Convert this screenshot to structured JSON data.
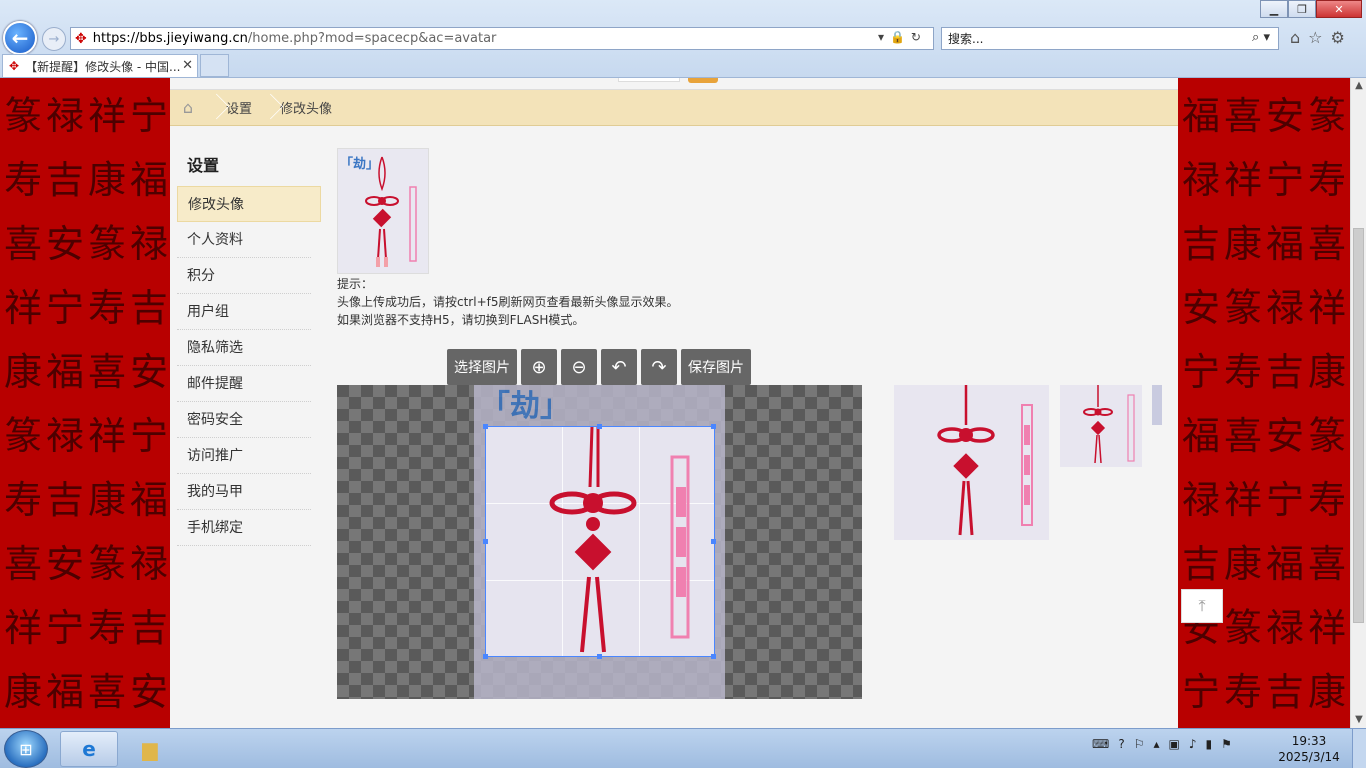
{
  "browser": {
    "window_controls": {
      "minimize": "▁",
      "maximize": "❐",
      "close": "✕"
    },
    "back_icon": "arrow-left-icon",
    "url_host": "https://bbs.jieyiwang.cn",
    "url_path": "/home.php?mod=spacecp&ac=avatar",
    "search_placeholder": "搜索...",
    "tab_title": "【新提醒】修改头像 - 中国...",
    "tab_close": "✕"
  },
  "breadcrumb": {
    "items": [
      "设置",
      "修改头像"
    ]
  },
  "sidebar": {
    "title": "设置",
    "items": [
      {
        "label": "修改头像",
        "active": true
      },
      {
        "label": "个人资料"
      },
      {
        "label": "积分"
      },
      {
        "label": "用户组"
      },
      {
        "label": "隐私筛选"
      },
      {
        "label": "邮件提醒"
      },
      {
        "label": "密码安全"
      },
      {
        "label": "访问推广"
      },
      {
        "label": "我的马甲"
      },
      {
        "label": "手机绑定"
      }
    ]
  },
  "avatar": {
    "hint_title": "提示：",
    "hint_line1": "头像上传成功后，请按ctrl+f5刷新网页查看最新头像显示效果。",
    "hint_line2": "如果浏览器不支持H5，请切换到FLASH模式。",
    "image_char": "「劫」"
  },
  "editor_toolbar": {
    "select_image": "选择图片",
    "zoom_in_icon": "zoom-in-icon",
    "zoom_out_icon": "zoom-out-icon",
    "rotate_left_icon": "rotate-left-icon",
    "rotate_right_icon": "rotate-right-icon",
    "save_image": "保存图片"
  },
  "taskbar": {
    "time": "19:33",
    "date": "2025/3/14"
  },
  "colors": {
    "accent_red": "#c00000",
    "crumb_bg": "#f3e3b9",
    "toolbar_bg": "#666666",
    "crop_border": "#4a86ff"
  }
}
